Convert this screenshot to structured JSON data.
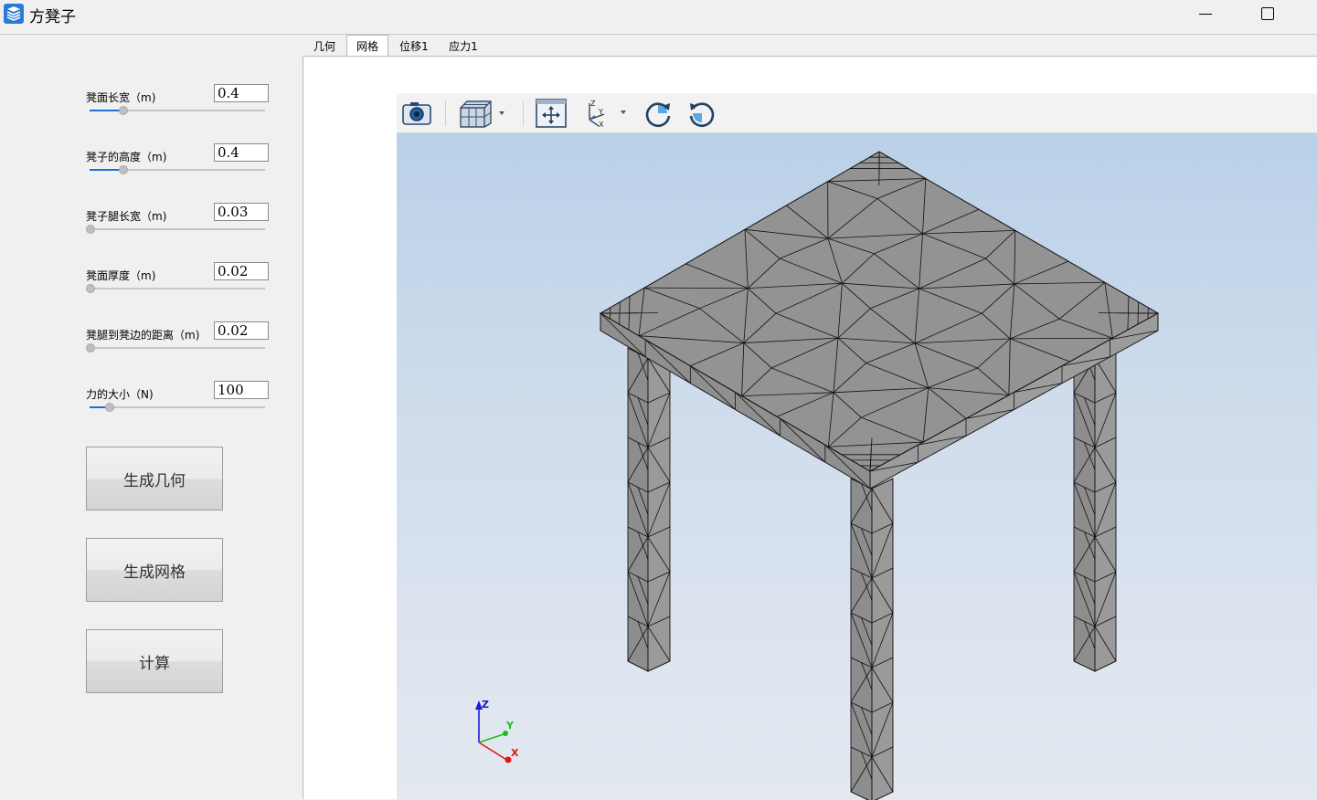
{
  "window": {
    "title": "方凳子",
    "app_icon": "app-logo-icon",
    "controls": [
      "minimize-icon",
      "maximize-icon"
    ]
  },
  "params": [
    {
      "label": "凳面长宽（m)",
      "value": "0.4",
      "slider_fraction": 0.19
    },
    {
      "label": "凳子的高度（m)",
      "value": "0.4",
      "slider_fraction": 0.19
    },
    {
      "label": "凳子腿长宽（m)",
      "value": "0.03",
      "slider_fraction": 0.0
    },
    {
      "label": "凳面厚度（m)",
      "value": "0.02",
      "slider_fraction": 0.0
    },
    {
      "label": "凳腿到凳边的距离（m)",
      "value": "0.02",
      "slider_fraction": 0.0
    },
    {
      "label": "力的大小（N)",
      "value": "100",
      "slider_fraction": 0.11
    }
  ],
  "buttons": {
    "geometry": "生成几何",
    "mesh": "生成网格",
    "compute": "计算"
  },
  "tabs": [
    {
      "label": "几何",
      "active": false
    },
    {
      "label": "网格",
      "active": true
    },
    {
      "label": "位移1",
      "active": false
    },
    {
      "label": "应力1",
      "active": false
    }
  ],
  "toolbar": {
    "icons": [
      "camera-icon",
      "view-cube-icon",
      "fit-view-icon",
      "axis-orientation-icon",
      "rotate-cw-icon",
      "rotate-ccw-icon"
    ]
  },
  "axis_triad": {
    "x": "X",
    "y": "Y",
    "z": "Z"
  },
  "colors": {
    "accent": "#1f6fd1",
    "mesh_fill": "#939393",
    "mesh_edge": "#111111",
    "axis_x": "#e02020",
    "axis_y": "#20c020",
    "axis_z": "#2020e0"
  }
}
